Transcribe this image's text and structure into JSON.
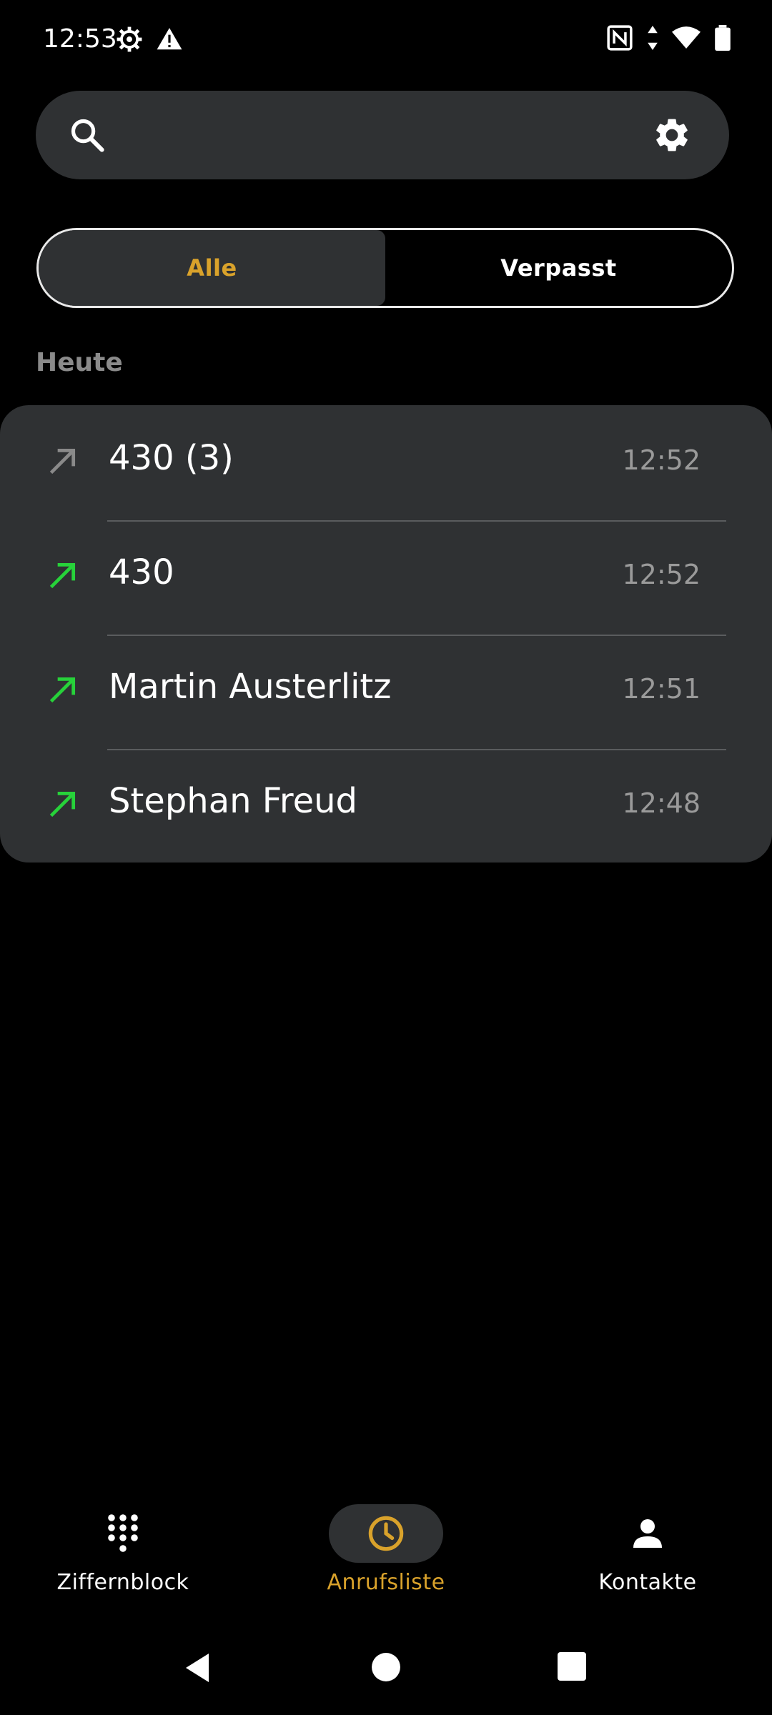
{
  "status_bar": {
    "time": "12:53",
    "left_icons": [
      "settings-gear-icon",
      "warning-icon"
    ],
    "right_icons": [
      "nfc-icon",
      "data-arrows-icon",
      "wifi-icon",
      "battery-icon"
    ]
  },
  "search": {
    "placeholder": "",
    "icon": "search-icon",
    "settings_icon": "gear-icon"
  },
  "tabs": [
    {
      "label": "Alle",
      "active": true
    },
    {
      "label": "Verpasst",
      "active": false
    }
  ],
  "section": {
    "title": "Heute"
  },
  "calls": [
    {
      "name": "430 (3)",
      "time": "12:52",
      "type": "outgoing",
      "arrow_color": "#8a8a8a"
    },
    {
      "name": "430",
      "time": "12:52",
      "type": "outgoing",
      "arrow_color": "#27d23a"
    },
    {
      "name": "Martin Austerlitz",
      "time": "12:51",
      "type": "outgoing",
      "arrow_color": "#27d23a"
    },
    {
      "name": "Stephan Freud",
      "time": "12:48",
      "type": "outgoing",
      "arrow_color": "#27d23a"
    }
  ],
  "bottom_nav": [
    {
      "label": "Ziffernblock",
      "icon": "dialpad-icon",
      "active": false
    },
    {
      "label": "Anrufsliste",
      "icon": "clock-icon",
      "active": true
    },
    {
      "label": "Kontakte",
      "icon": "person-icon",
      "active": false
    }
  ],
  "colors": {
    "accent": "#d9a22b",
    "surface": "#2f3133",
    "background": "#000000",
    "call_green": "#27d23a"
  }
}
